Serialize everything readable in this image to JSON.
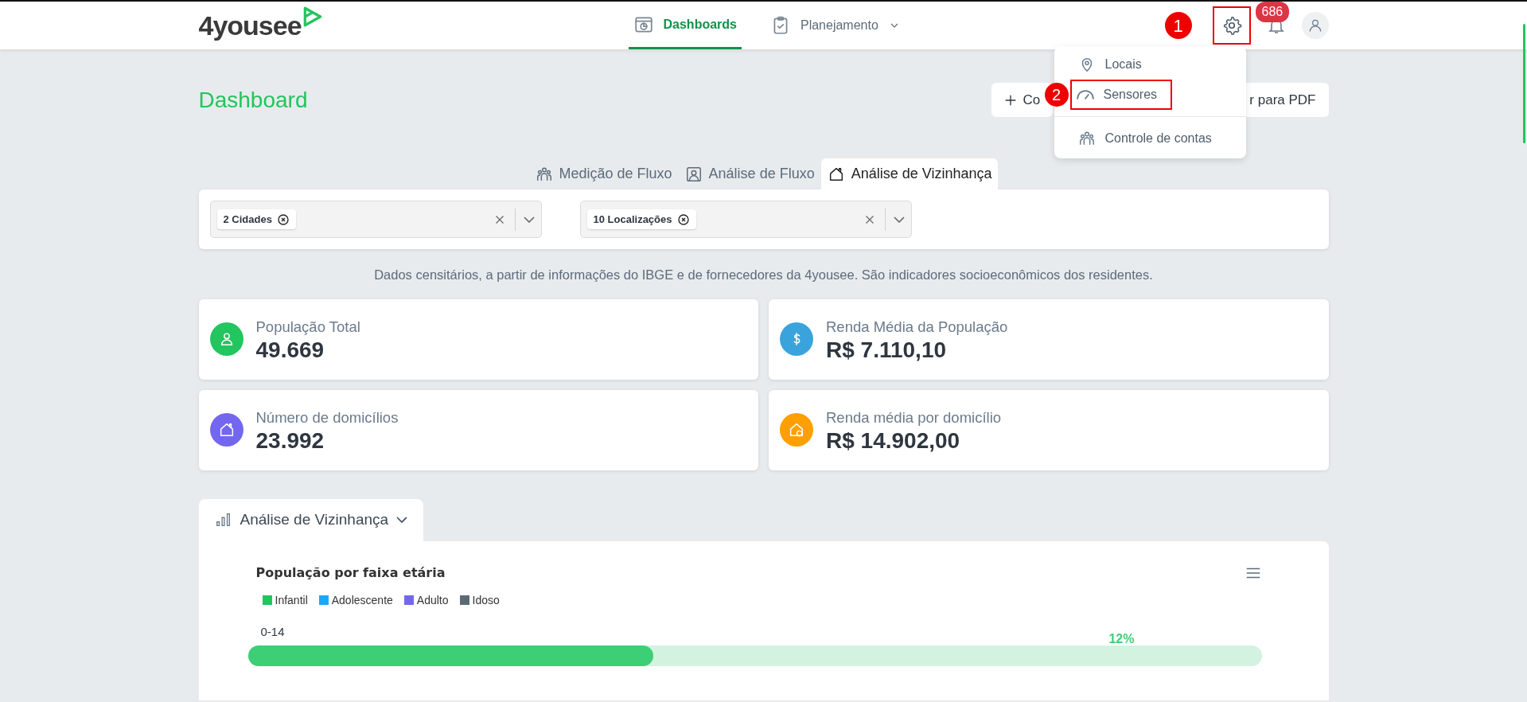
{
  "header": {
    "logo": "4yousee",
    "nav": [
      {
        "label": "Dashboards",
        "kind": "link",
        "selected": true
      },
      {
        "label": "Planejamento",
        "kind": "dropdown",
        "selected": false
      }
    ],
    "notifications": {
      "count": "686"
    },
    "settings": {
      "highlighted": true,
      "annotation": "1"
    },
    "settings_menu": [
      [
        {
          "label": "Locais",
          "highlighted": false
        },
        {
          "label": "Sensores",
          "highlighted": true,
          "annotation": "2"
        }
      ],
      [
        {
          "label": "Controle de contas",
          "highlighted": false
        }
      ]
    ]
  },
  "page": {
    "title": "Dashboard",
    "actions": [
      {
        "label": "Co"
      },
      {
        "label": "r para PDF"
      }
    ]
  },
  "tabs": [
    {
      "label": "Medição de Fluxo",
      "selected": false
    },
    {
      "label": "Análise de Fluxo",
      "selected": false
    },
    {
      "label": "Análise de Vizinhança",
      "selected": true
    }
  ],
  "filters": [
    {
      "chip": "2 Cidades"
    },
    {
      "chip": "10 Localizações"
    }
  ],
  "description": "Dados censitários, a partir de informações do IBGE e de fornecedores da 4yousee. São indicadores socioeconômicos dos residentes.",
  "stats": [
    {
      "label": "População Total",
      "value": "49.669",
      "color": "#22c55e"
    },
    {
      "label": "Renda Média da População",
      "value": "R$ 7.110,10",
      "color": "#3aa3dc"
    },
    {
      "label": "Número de domicílios",
      "value": "23.992",
      "color": "#7367f0"
    },
    {
      "label": "Renda média por domicílio",
      "value": "R$ 14.902,00",
      "color": "#ff9f00"
    }
  ],
  "section": {
    "label": "Análise de Vizinhança",
    "expanded": false,
    "chart": {
      "title": "População por faixa etária",
      "legend": [
        {
          "label": "Infantil",
          "color": "#22c55e"
        },
        {
          "label": "Adolescente",
          "color": "#1ea7f5"
        },
        {
          "label": "Adulto",
          "color": "#7367f0"
        },
        {
          "label": "Idoso",
          "color": "#5c6b73"
        }
      ],
      "rows": [
        {
          "label": "0-14",
          "value": "12%",
          "level": 0.4,
          "color": "#3ccf75"
        }
      ]
    }
  }
}
